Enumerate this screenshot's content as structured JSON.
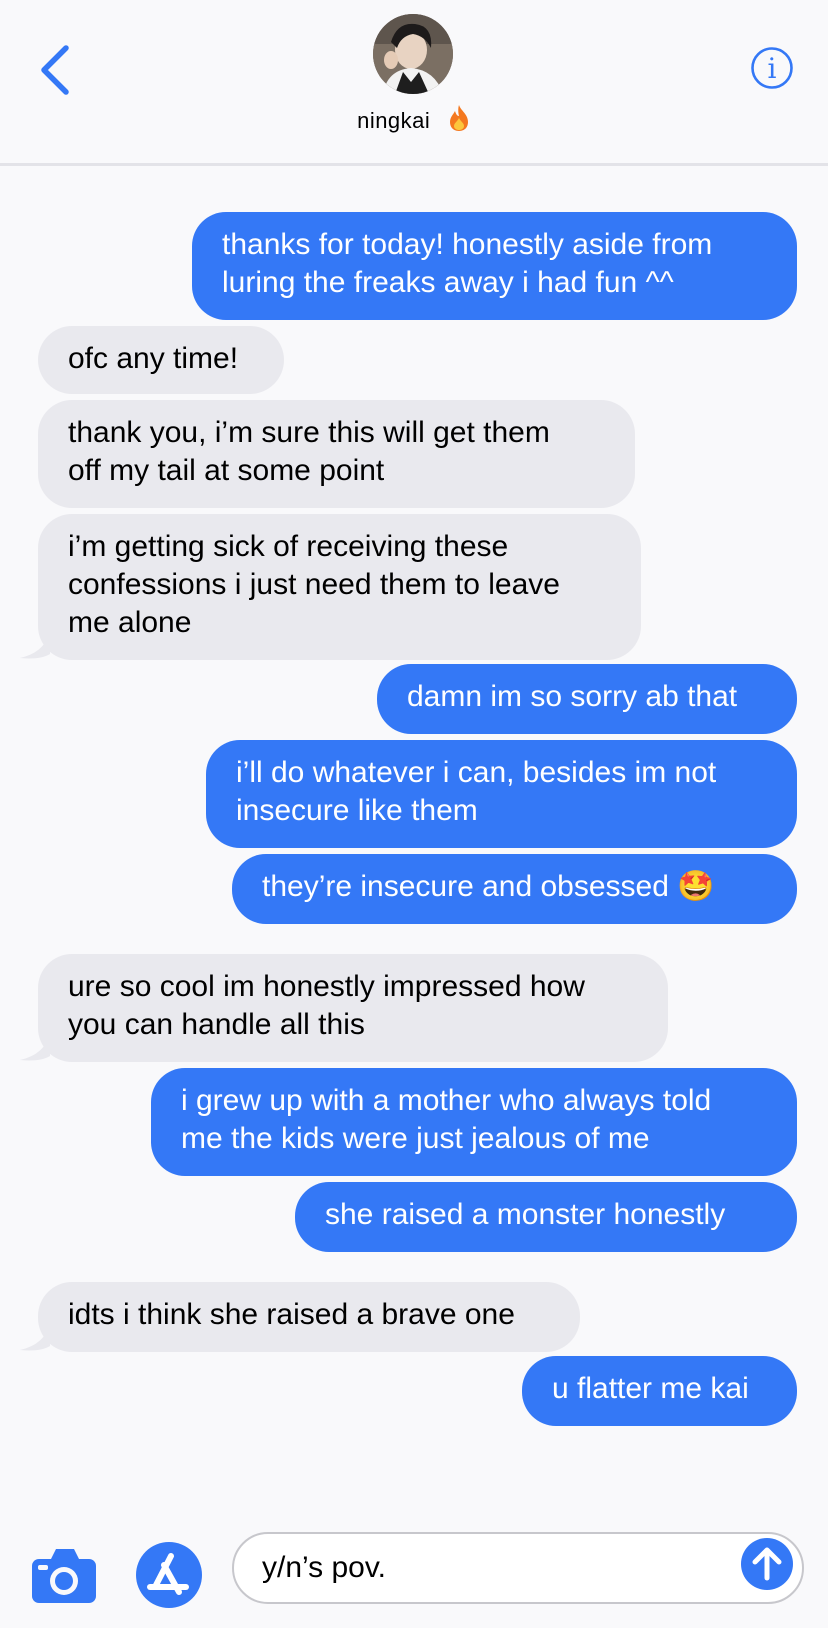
{
  "header": {
    "contact_name": "ningkai",
    "contact_emoji": "fire"
  },
  "colors": {
    "accent": "#3478f6",
    "incoming_bubble": "#e9e9ee",
    "background": "#f9f9fb"
  },
  "messages": [
    {
      "from": "me",
      "text": "thanks for today! honestly aside from\nluring the freaks away i had fun ^^"
    },
    {
      "from": "them",
      "text": "ofc any time!"
    },
    {
      "from": "them",
      "text": "thank you, i’m sure this will get them\noff my tail at some point"
    },
    {
      "from": "them",
      "text": "i’m getting sick of receiving these\nconfessions i just need them to leave\nme alone"
    },
    {
      "from": "me",
      "text": "damn im so sorry ab that"
    },
    {
      "from": "me",
      "text": "i’ll do whatever i can, besides im not\ninsecure like them"
    },
    {
      "from": "me",
      "text": "they’re insecure and obsessed 🤩"
    },
    {
      "from": "them",
      "text": "ure so cool im honestly impressed how\nyou can handle all this"
    },
    {
      "from": "me",
      "text": "i grew up with a mother who always told\nme the kids were just jealous of me"
    },
    {
      "from": "me",
      "text": "she raised a monster honestly"
    },
    {
      "from": "them",
      "text": "idts i think she raised a brave one"
    },
    {
      "from": "me",
      "text": "u flatter me kai"
    }
  ],
  "composer": {
    "input_value": "y/n’s pov.",
    "icons": [
      "camera-icon",
      "app-store-icon",
      "send-arrow-icon"
    ]
  }
}
